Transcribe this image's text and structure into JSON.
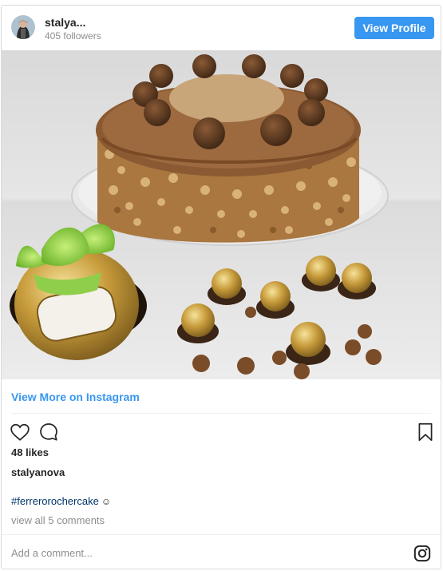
{
  "header": {
    "username": "stalya...",
    "followers": "405 followers",
    "view_profile_label": "View Profile"
  },
  "post": {
    "view_more_label": "View More on Instagram",
    "likes": "48 likes",
    "caption_user": "stalyanova",
    "hashtag": "#ferrerorochercake",
    "emoji": "☺",
    "comments_link": "view all 5 comments",
    "comment_placeholder": "Add a comment..."
  },
  "icons": {
    "like": "heart-icon",
    "comment": "comment-icon",
    "save": "bookmark-icon",
    "instagram": "instagram-icon"
  },
  "colors": {
    "accent": "#3897f0",
    "hashtag": "#003569",
    "muted": "#8e8e8e"
  }
}
